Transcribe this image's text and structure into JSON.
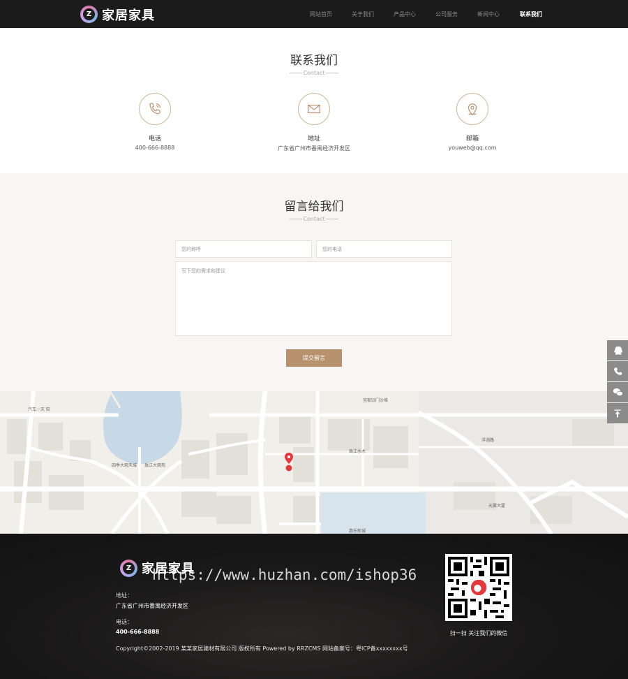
{
  "brand": {
    "name": "家居家具",
    "logo_letter": "Z"
  },
  "nav": {
    "items": [
      {
        "label": "网站首页",
        "active": false
      },
      {
        "label": "关于我们",
        "active": false
      },
      {
        "label": "产品中心",
        "active": false
      },
      {
        "label": "公司服务",
        "active": false
      },
      {
        "label": "新闻中心",
        "active": false
      },
      {
        "label": "联系我们",
        "active": true
      }
    ]
  },
  "contact": {
    "title": "联系我们",
    "subtitle": "Contact",
    "items": [
      {
        "label": "电话",
        "value": "400-666-8888",
        "icon": "phone-icon"
      },
      {
        "label": "地址",
        "value": "广东省广州市番禺经济开发区",
        "icon": "mail-icon"
      },
      {
        "label": "邮箱",
        "value": "youweb@qq.com",
        "icon": "location-icon"
      }
    ]
  },
  "message": {
    "title": "留言给我们",
    "subtitle": "Contact",
    "name_placeholder": "您的称呼",
    "phone_placeholder": "您的电话",
    "content_placeholder": "写下您的需求和建议",
    "submit_label": "提交留言"
  },
  "map": {
    "labels": {
      "l1": "汽车一天 馆",
      "l2": "四季大观天城",
      "l3": "珠江大观苑",
      "l4": "宜家旧门沙堆",
      "l5": "珠江水木",
      "l6": "洋湖路",
      "l7": "天翼大厦",
      "l8": "惠乐新城"
    }
  },
  "sidebar": {
    "tools": [
      {
        "icon": "qq-icon"
      },
      {
        "icon": "phone-icon"
      },
      {
        "icon": "wechat-icon"
      },
      {
        "icon": "back-to-top-icon"
      }
    ]
  },
  "footer": {
    "brand": "家居家具",
    "address_label": "地址：",
    "address": "广东省广州市番禺经济开发区",
    "phone_label": "电话：",
    "phone": "400-666-8888",
    "qr_caption": "扫一扫 关注我们的微信",
    "copyright": "Copyright©2002-2019 某某家居建材有限公司 版权所有 Powered by RRZCMS 网站备案号：粤ICP备xxxxxxxx号",
    "watermark": "https://www.huzhan.com/ishop36"
  },
  "colors": {
    "accent": "#b8916f",
    "header_bg": "#1b1b1b",
    "footer_bg": "#141414",
    "section_bg": "#f7f6f4"
  }
}
